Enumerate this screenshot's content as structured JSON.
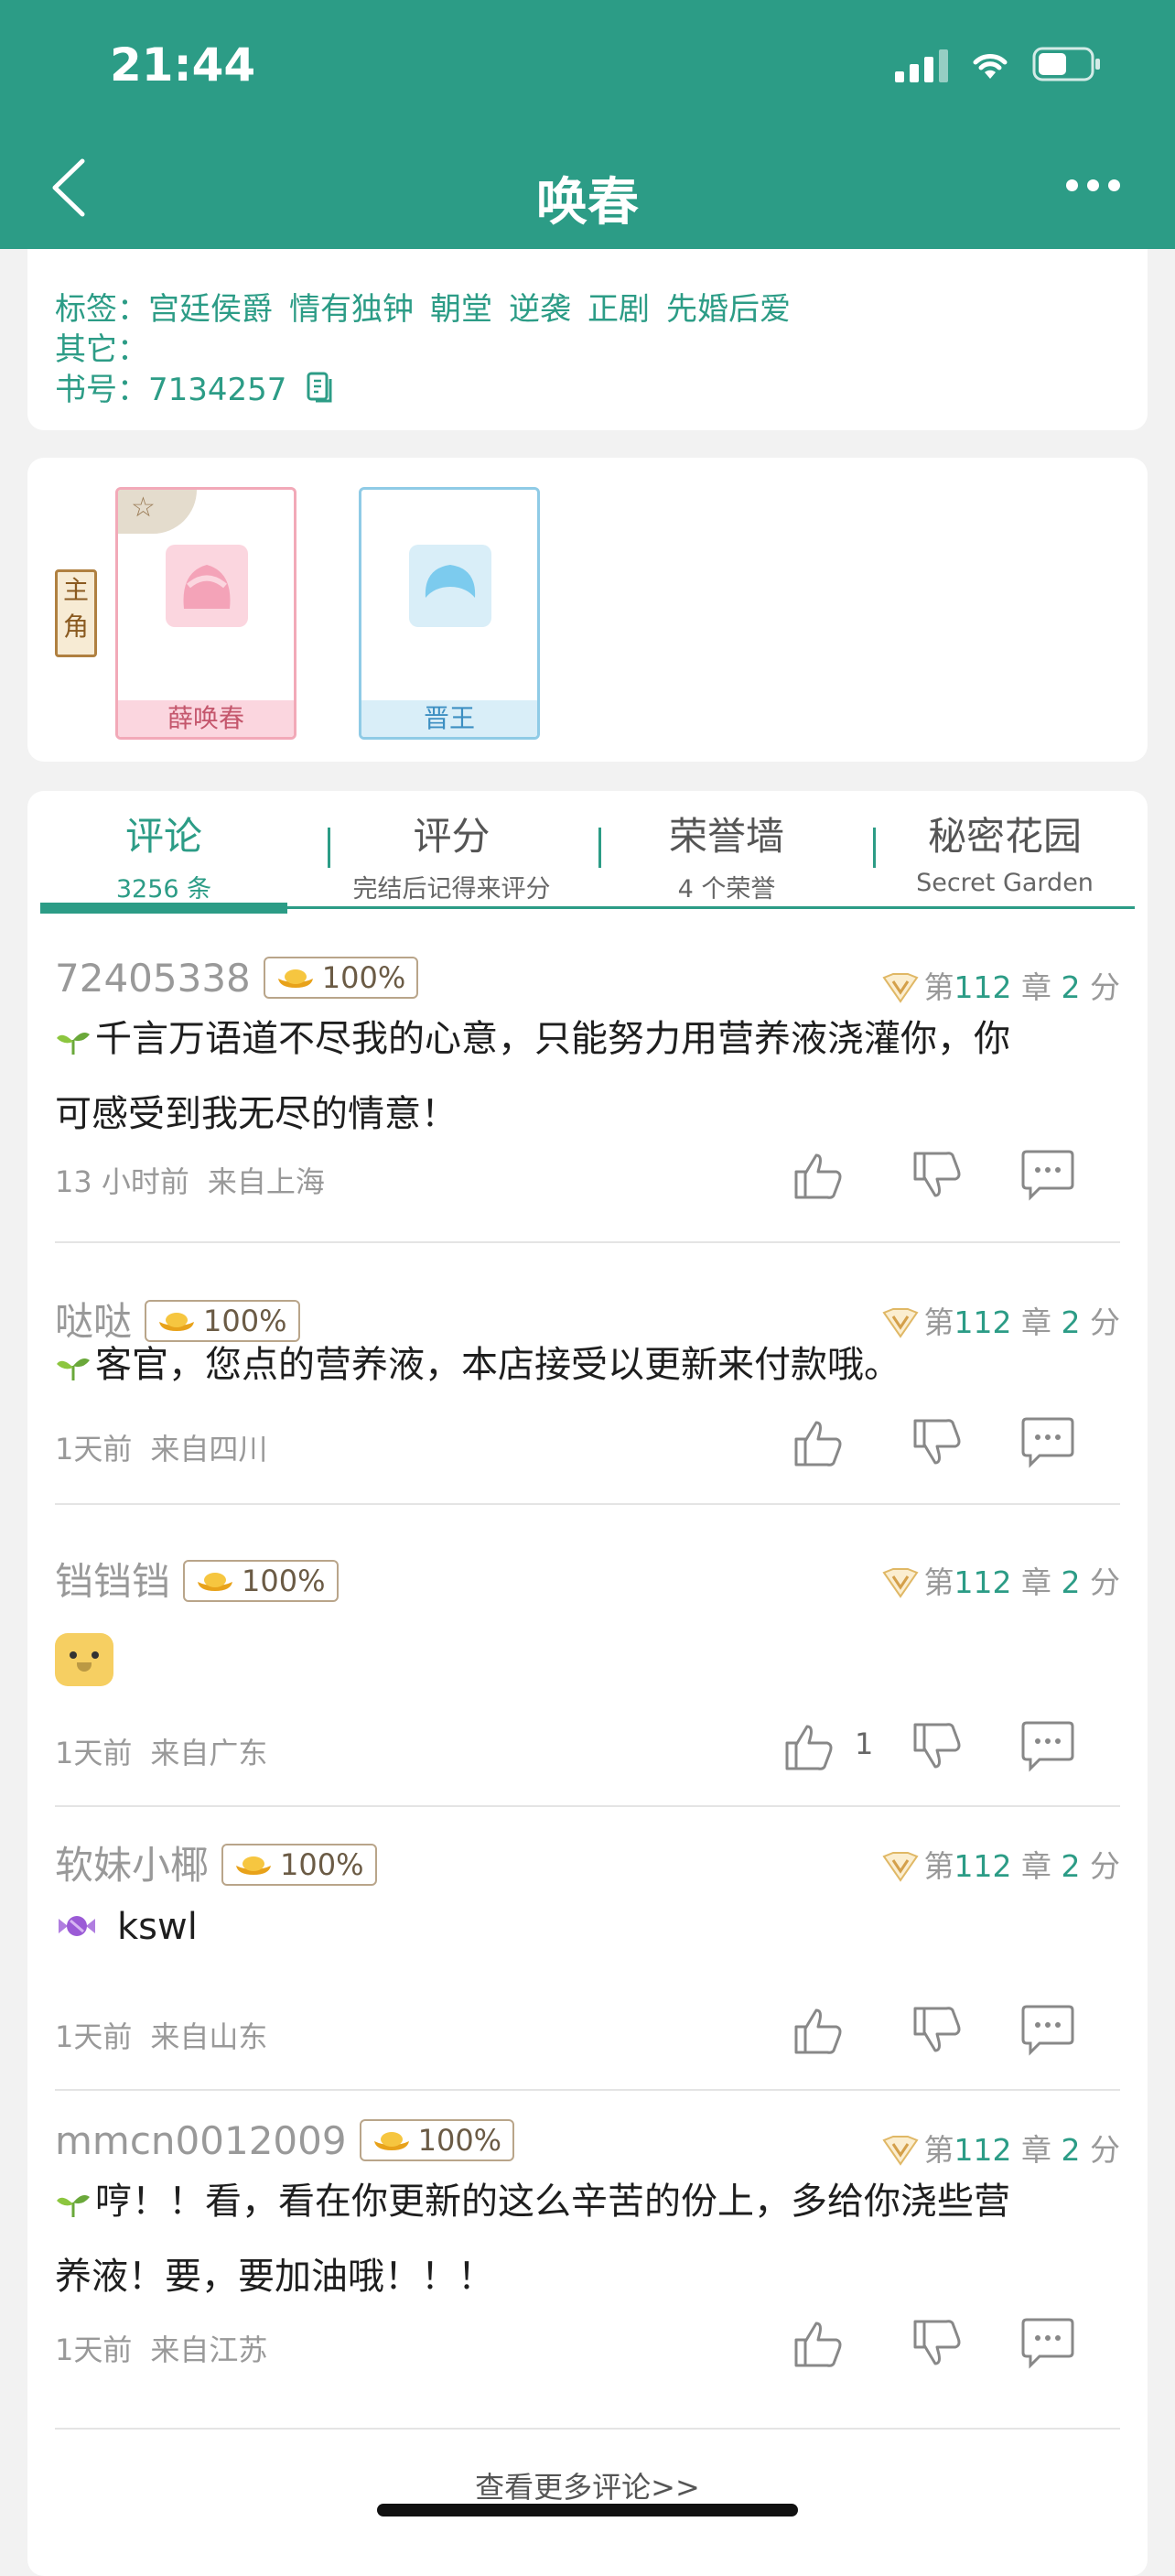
{
  "status_bar": {
    "time": "21:44"
  },
  "nav": {
    "title": "唤春"
  },
  "info": {
    "tags_label": "标签：",
    "tags": [
      "宫廷侯爵",
      "情有独钟",
      "朝堂",
      "逆袭",
      "正剧",
      "先婚后爱"
    ],
    "other_label": "其它：",
    "book_label": "书号：",
    "book_id": "7134257"
  },
  "roles": {
    "side_label": "主角",
    "items": [
      {
        "name": "薛唤春"
      },
      {
        "name": "晋王"
      }
    ]
  },
  "tabs": [
    {
      "title": "评论",
      "sub": "3256 条"
    },
    {
      "title": "评分",
      "sub": "完结后记得来评分"
    },
    {
      "title": "荣誉墙",
      "sub": "4 个荣誉"
    },
    {
      "title": "秘密花园",
      "sub": "Secret Garden"
    }
  ],
  "comments": [
    {
      "user": "72405338",
      "badge": "100%",
      "chapter_prefix": "第",
      "chapter": "112",
      "chapter_suffix": "章",
      "score": "2",
      "score_suffix": "分",
      "line1": "千言万语道不尽我的心意，只能努力用营养液浇灌你，你",
      "line2": "可感受到我无尽的情意！",
      "time": "13 小时前",
      "location": "来自上海"
    },
    {
      "user": "哒哒",
      "badge": "100%",
      "chapter_prefix": "第",
      "chapter": "112",
      "chapter_suffix": "章",
      "score": "2",
      "score_suffix": "分",
      "line1": "客官，您点的营养液，本店接受以更新来付款哦。",
      "time": "1天前",
      "location": "来自四川"
    },
    {
      "user": "铛铛铛",
      "badge": "100%",
      "chapter_prefix": "第",
      "chapter": "112",
      "chapter_suffix": "章",
      "score": "2",
      "score_suffix": "分",
      "time": "1天前",
      "location": "来自广东",
      "likes": "1"
    },
    {
      "user": "软妹小椰",
      "badge": "100%",
      "chapter_prefix": "第",
      "chapter": "112",
      "chapter_suffix": "章",
      "score": "2",
      "score_suffix": "分",
      "line1": "kswl",
      "time": "1天前",
      "location": "来自山东"
    },
    {
      "user": "mmcn0012009",
      "badge": "100%",
      "chapter_prefix": "第",
      "chapter": "112",
      "chapter_suffix": "章",
      "score": "2",
      "score_suffix": "分",
      "line1": "哼！！看，看在你更新的这么辛苦的份上，多给你浇些营",
      "line2": "养液！要，要加油哦！！！",
      "time": "1天前",
      "location": "来自江苏"
    }
  ],
  "more_link": "查看更多评论>>",
  "colors": {
    "accent": "#2c9c86",
    "bg": "#f2f2f2"
  }
}
